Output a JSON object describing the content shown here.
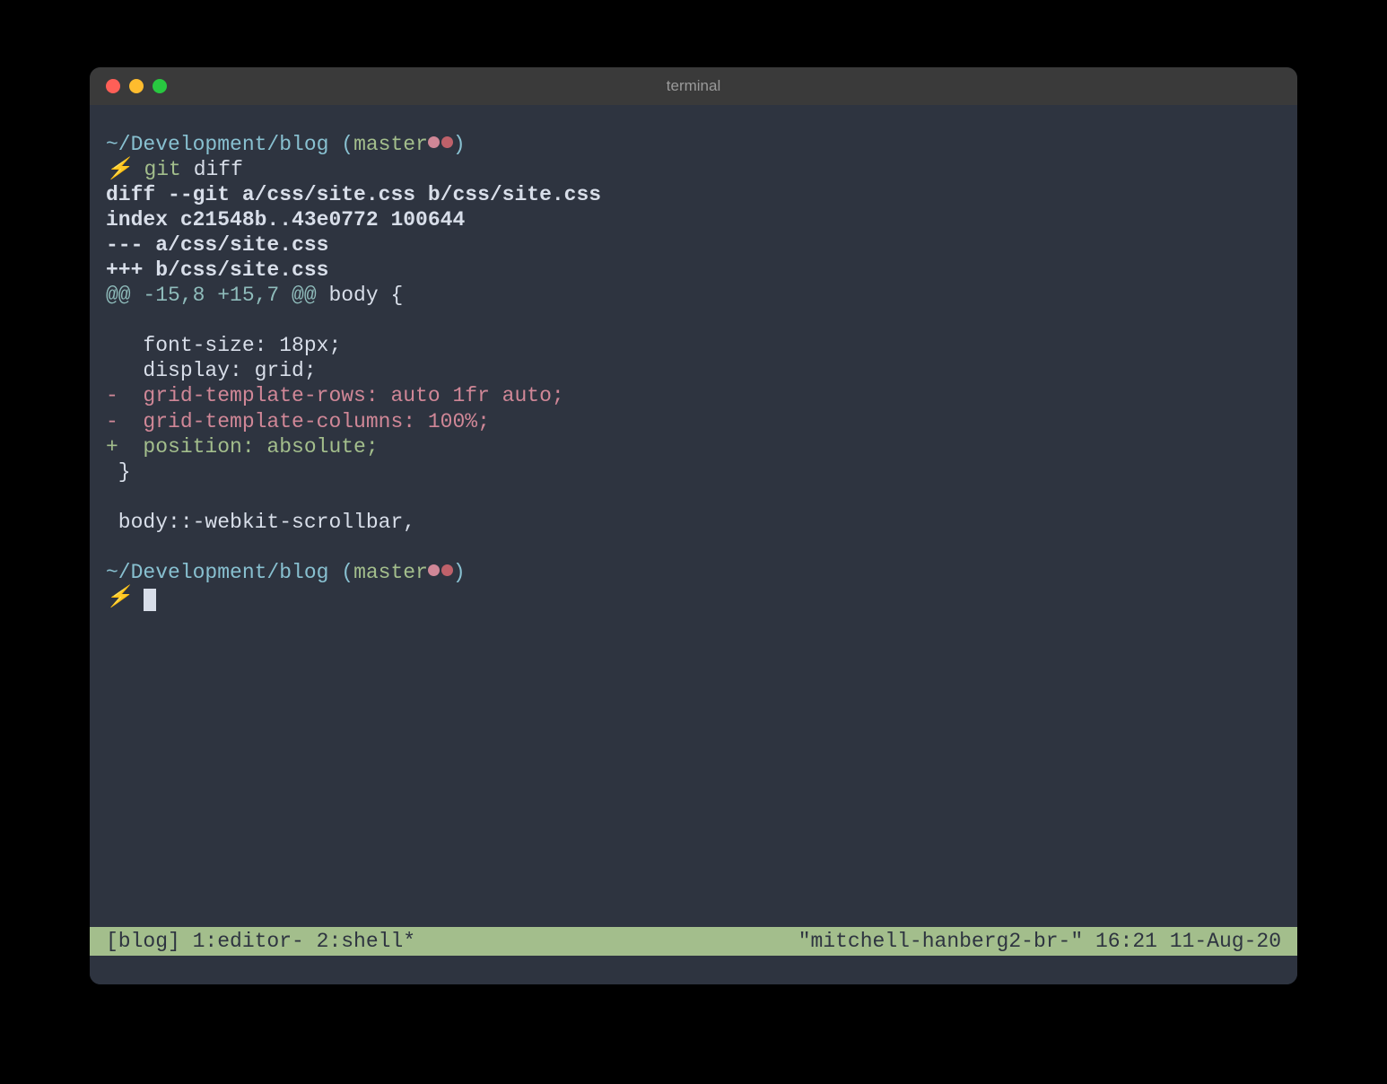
{
  "window": {
    "title": "terminal"
  },
  "prompt1": {
    "cwd": "~/Development/blog",
    "paren_open": " (",
    "branch": "master",
    "paren_close": ")",
    "symbol": "⚡",
    "command": "git",
    "args": "diff"
  },
  "diff": {
    "header1": "diff --git a/css/site.css b/css/site.css",
    "header2": "index c21548b..43e0772 100644",
    "header3": "--- a/css/site.css",
    "header4": "+++ b/css/site.css",
    "hunk_marker": "@@ -15,8 +15,7 @@",
    "hunk_context": " body {",
    "ctx1": "   font-size: 18px;",
    "ctx2": "   display: grid;",
    "del1": "-  grid-template-rows: auto 1fr auto;",
    "del2": "-  grid-template-columns: 100%;",
    "add1": "+  position: absolute;",
    "ctx3": " }",
    "ctx4": " body::-webkit-scrollbar,"
  },
  "prompt2": {
    "cwd": "~/Development/blog",
    "paren_open": " (",
    "branch": "master",
    "paren_close": ")",
    "symbol": "⚡"
  },
  "tmux": {
    "left": "[blog] 1:editor- 2:shell*",
    "right": "\"mitchell-hanberg2-br-\" 16:21 11-Aug-20"
  }
}
